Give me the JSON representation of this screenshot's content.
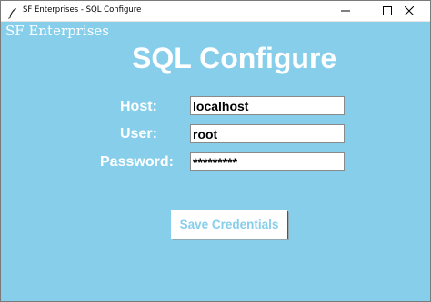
{
  "window": {
    "title": "SF Enterprises - SQL Configure",
    "icons": [
      "feather-icon",
      "minimize-icon",
      "maximize-icon",
      "close-icon"
    ]
  },
  "brand": "SF Enterprises",
  "heading": "SQL Configure",
  "form": {
    "host_label": "Host:",
    "host_value": "localhost",
    "user_label": "User:",
    "user_value": "root",
    "password_label": "Password:",
    "password_value": "*********"
  },
  "save_button": "Save Credentials",
  "colors": {
    "background": "#87ceeb",
    "text": "#ffffff",
    "button_text": "#87ceeb"
  }
}
